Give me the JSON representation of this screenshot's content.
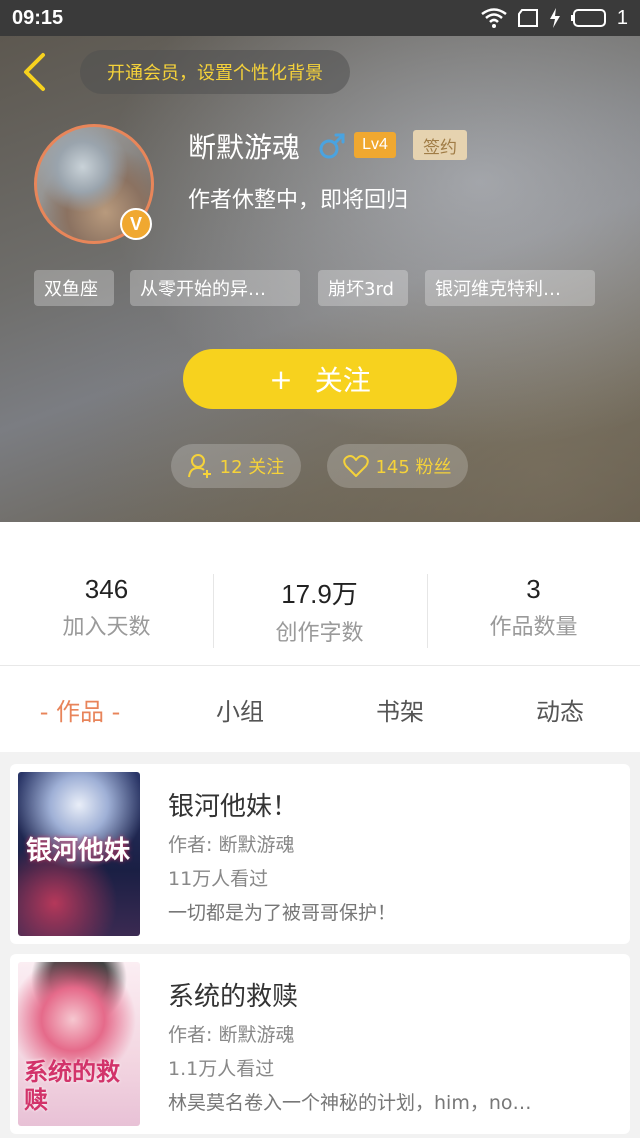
{
  "status_bar": {
    "time": "09:15",
    "battery_text": "1"
  },
  "header": {
    "vip_banner": "开通会员，设置个性化背景",
    "username": "断默游魂",
    "level": "Lv4",
    "signed_badge": "签约",
    "bio": "作者休整中，即将回归",
    "verified_badge": "V",
    "tags": [
      "双鱼座",
      "从零开始的异…",
      "崩坏3rd",
      "银河维克特利…"
    ],
    "follow_button": "关注",
    "follow_plus": "+",
    "following": "12 关注",
    "fans": "145 粉丝"
  },
  "stats": [
    {
      "value": "346",
      "label": "加入天数"
    },
    {
      "value": "17.9万",
      "label": "创作字数"
    },
    {
      "value": "3",
      "label": "作品数量"
    }
  ],
  "tabs": [
    "- 作品 -",
    "小组",
    "书架",
    "动态"
  ],
  "books": [
    {
      "title": "银河他妹！",
      "author": "作者: 断默游魂",
      "views": "11万人看过",
      "desc": "一切都是为了被哥哥保护！",
      "cover_text": "银河他妹"
    },
    {
      "title": "系统的救赎",
      "author": "作者: 断默游魂",
      "views": "1.1万人看过",
      "desc": "林昊莫名卷入一个神秘的计划，him，no…",
      "cover_text": "系统的救赎"
    }
  ],
  "colors": {
    "accent": "#f7d21e",
    "tab_active": "#e8845a",
    "gender": "#4aa3e0",
    "level": "#f0a830"
  }
}
